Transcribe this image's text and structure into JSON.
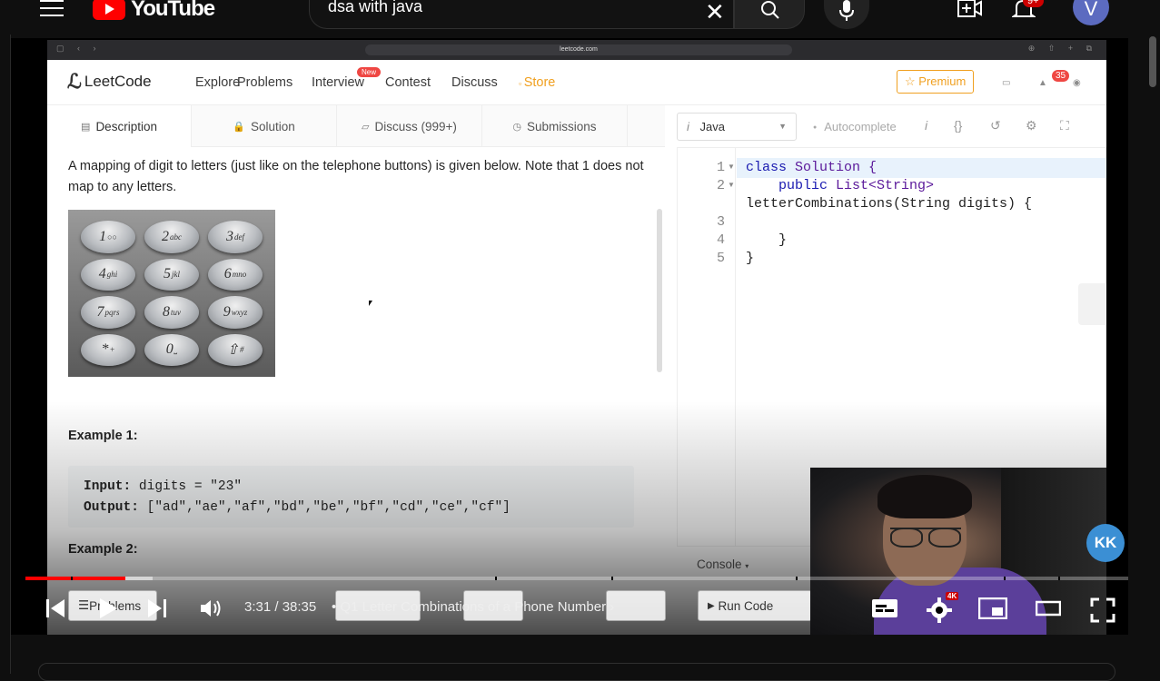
{
  "youtube": {
    "logo_text": "YouTube",
    "search_value": "dsa with java",
    "notifications_badge": "9+",
    "avatar_letter": "V"
  },
  "browser": {
    "url": "leetcode.com"
  },
  "leetcode": {
    "logo_text": "LeetCode",
    "nav": {
      "explore": "Explore",
      "problems": "Problems",
      "interview": "Interview",
      "new_badge": "New",
      "contest": "Contest",
      "discuss": "Discuss",
      "store": "Store",
      "premium": "Premium",
      "notification_count": "35"
    },
    "tabs": {
      "description": "Description",
      "solution": "Solution",
      "discuss": "Discuss (999+)",
      "submissions": "Submissions"
    },
    "description": {
      "text": "A mapping of digit to letters (just like on the telephone buttons) is given below. Note that 1 does not map to any letters.",
      "keypad": [
        {
          "digit": "1",
          "letters": "○○"
        },
        {
          "digit": "2",
          "letters": "abc"
        },
        {
          "digit": "3",
          "letters": "def"
        },
        {
          "digit": "4",
          "letters": "ghi"
        },
        {
          "digit": "5",
          "letters": "jkl"
        },
        {
          "digit": "6",
          "letters": "mno"
        },
        {
          "digit": "7",
          "letters": "pqrs"
        },
        {
          "digit": "8",
          "letters": "tuv"
        },
        {
          "digit": "9",
          "letters": "wxyz"
        },
        {
          "digit": "*",
          "letters": "+"
        },
        {
          "digit": "0",
          "letters": "⎵"
        },
        {
          "digit": "⇧",
          "letters": "#"
        }
      ],
      "example1_title": "Example 1:",
      "example1_input_label": "Input:",
      "example1_input": " digits = \"23\"",
      "example1_output_label": "Output:",
      "example1_output": " [\"ad\",\"ae\",\"af\",\"bd\",\"be\",\"bf\",\"cd\",\"ce\",\"cf\"]",
      "example2_title": "Example 2:"
    },
    "editor": {
      "language": "Java",
      "autocomplete": "Autocomplete",
      "line_numbers": [
        "1",
        "2",
        "3",
        "4",
        "5"
      ],
      "code": {
        "l1_kw": "class",
        "l1_rest": " Solution {",
        "l2_indent": "    ",
        "l2_kw": "public",
        "l2_ty": " List<String>",
        "l2b": "letterCombinations(String digits) {",
        "l4": "    }",
        "l5": "}"
      },
      "console": "Console",
      "run_code": "Run Code"
    },
    "bottom_problems": "Problems"
  },
  "player": {
    "time": "3:31 / 38:35",
    "chapter": "Q1 Letter Combinations of a Phone Number",
    "played_fraction": 0.091,
    "hd_badge": "4K",
    "overlay_logo": "KK"
  }
}
